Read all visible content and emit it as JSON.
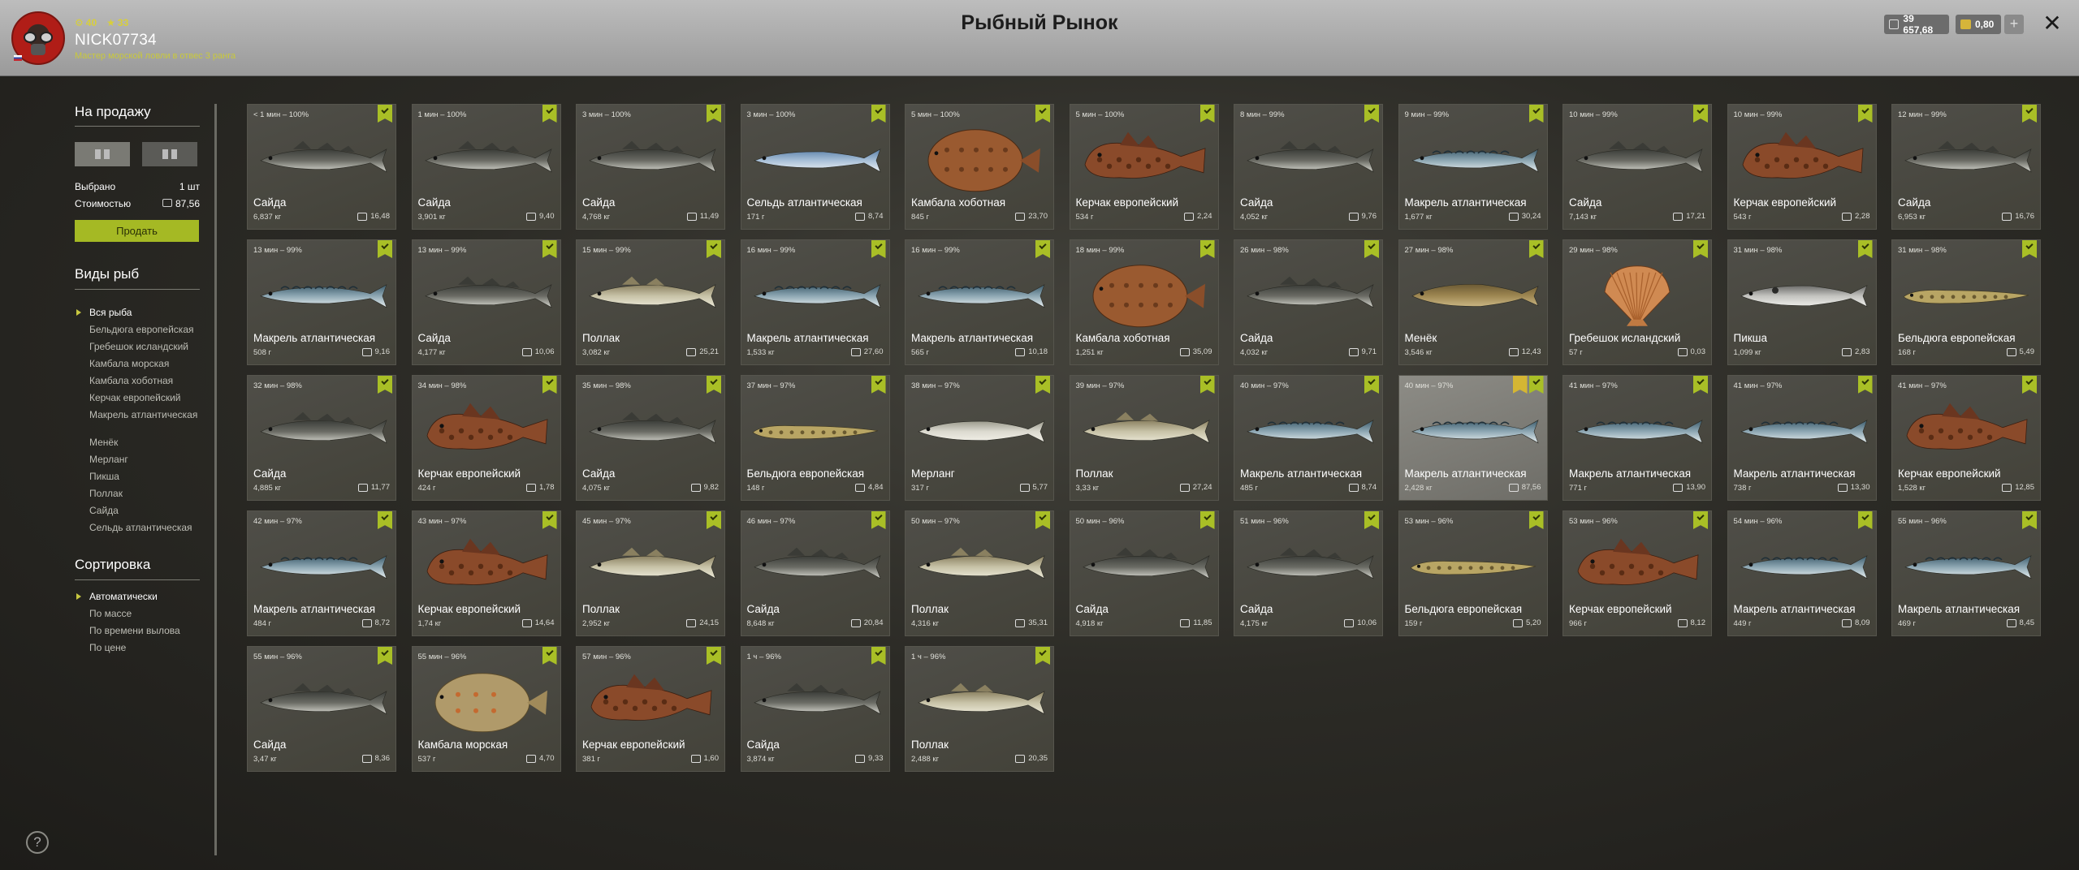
{
  "header": {
    "page_title": "Рыбный Рынок",
    "user": {
      "level": "40",
      "rank": "33",
      "name": "NICK07734",
      "title": "Мастер морской ловли в отвес 3 ранга"
    },
    "currency": {
      "silver": "39 657,68",
      "gold": "0,80"
    },
    "plus_label": "+",
    "close_label": "✕"
  },
  "left": {
    "sale_title": "На продажу",
    "selected_label": "Выбрано",
    "selected_value": "1 шт",
    "cost_label": "Стоимостью",
    "cost_value": "87,56",
    "sell_button": "Продать",
    "species_title": "Виды рыб",
    "species": [
      "Вся рыба",
      "Бельдюга европейская",
      "Гребешок исландский",
      "Камбала морская",
      "Камбала хоботная",
      "Керчак европейский",
      "Макрель атлантическая",
      "Менёк",
      "Мерланг",
      "Пикша",
      "Поллак",
      "Сайда",
      "Сельдь атлантическая"
    ],
    "sort_title": "Сортировка",
    "sort": [
      "Автоматически",
      "По массе",
      "По времени вылова",
      "По цене"
    ],
    "help": "?"
  },
  "icons": {
    "close": "close-icon",
    "check": "check-icon",
    "coin": "coin-icon",
    "help": "help-icon",
    "grid": "grid-view-icon"
  },
  "colors": {
    "accent": "#a9bf26",
    "gold": "#d5b633",
    "card": "#4a4943"
  },
  "catches": [
    {
      "time": "< 1 мин – 100%",
      "name": "Сайда",
      "weight": "6,837 кг",
      "price": "16,48",
      "kind": "saithe"
    },
    {
      "time": "1 мин – 100%",
      "name": "Сайда",
      "weight": "3,901 кг",
      "price": "9,40",
      "kind": "saithe"
    },
    {
      "time": "3 мин – 100%",
      "name": "Сайда",
      "weight": "4,768 кг",
      "price": "11,49",
      "kind": "saithe"
    },
    {
      "time": "3 мин – 100%",
      "name": "Сельдь атлантическая",
      "weight": "171 г",
      "price": "8,74",
      "kind": "herring"
    },
    {
      "time": "5 мин – 100%",
      "name": "Камбала хоботная",
      "weight": "845 г",
      "price": "23,70",
      "kind": "flounder"
    },
    {
      "time": "5 мин – 100%",
      "name": "Керчак европейский",
      "weight": "534 г",
      "price": "2,24",
      "kind": "sculpin"
    },
    {
      "time": "8 мин – 99%",
      "name": "Сайда",
      "weight": "4,052 кг",
      "price": "9,76",
      "kind": "saithe"
    },
    {
      "time": "9 мин – 99%",
      "name": "Макрель атлантическая",
      "weight": "1,677 кг",
      "price": "30,24",
      "kind": "mackerel"
    },
    {
      "time": "10 мин – 99%",
      "name": "Сайда",
      "weight": "7,143 кг",
      "price": "17,21",
      "kind": "saithe"
    },
    {
      "time": "10 мин – 99%",
      "name": "Керчак европейский",
      "weight": "543 г",
      "price": "2,28",
      "kind": "sculpin"
    },
    {
      "time": "12 мин – 99%",
      "name": "Сайда",
      "weight": "6,953 кг",
      "price": "16,76",
      "kind": "saithe"
    },
    {
      "time": "13 мин – 99%",
      "name": "Макрель атлантическая",
      "weight": "508 г",
      "price": "9,16",
      "kind": "mackerel"
    },
    {
      "time": "13 мин – 99%",
      "name": "Сайда",
      "weight": "4,177 кг",
      "price": "10,06",
      "kind": "saithe"
    },
    {
      "time": "15 мин – 99%",
      "name": "Поллак",
      "weight": "3,082 кг",
      "price": "25,21",
      "kind": "pollack"
    },
    {
      "time": "16 мин – 99%",
      "name": "Макрель атлантическая",
      "weight": "1,533 кг",
      "price": "27,60",
      "kind": "mackerel"
    },
    {
      "time": "16 мин – 99%",
      "name": "Макрель атлантическая",
      "weight": "565 г",
      "price": "10,18",
      "kind": "mackerel"
    },
    {
      "time": "18 мин – 99%",
      "name": "Камбала хоботная",
      "weight": "1,251 кг",
      "price": "35,09",
      "kind": "flounder"
    },
    {
      "time": "26 мин – 98%",
      "name": "Сайда",
      "weight": "4,032 кг",
      "price": "9,71",
      "kind": "saithe"
    },
    {
      "time": "27 мин – 98%",
      "name": "Менёк",
      "weight": "3,546 кг",
      "price": "12,43",
      "kind": "tusk"
    },
    {
      "time": "29 мин – 98%",
      "name": "Гребешок исландский",
      "weight": "57 г",
      "price": "0,03",
      "kind": "scallop"
    },
    {
      "time": "31 мин – 98%",
      "name": "Пикша",
      "weight": "1,099 кг",
      "price": "2,83",
      "kind": "haddock"
    },
    {
      "time": "31 мин – 98%",
      "name": "Бельдюга европейская",
      "weight": "168 г",
      "price": "5,49",
      "kind": "eelpout"
    },
    {
      "time": "32 мин – 98%",
      "name": "Сайда",
      "weight": "4,885 кг",
      "price": "11,77",
      "kind": "saithe"
    },
    {
      "time": "34 мин – 98%",
      "name": "Керчак европейский",
      "weight": "424 г",
      "price": "1,78",
      "kind": "sculpin"
    },
    {
      "time": "35 мин – 98%",
      "name": "Сайда",
      "weight": "4,075 кг",
      "price": "9,82",
      "kind": "saithe"
    },
    {
      "time": "37 мин – 97%",
      "name": "Бельдюга европейская",
      "weight": "148 г",
      "price": "4,84",
      "kind": "eelpout"
    },
    {
      "time": "38 мин – 97%",
      "name": "Мерланг",
      "weight": "317 г",
      "price": "5,77",
      "kind": "whiting"
    },
    {
      "time": "39 мин – 97%",
      "name": "Поллак",
      "weight": "3,33 кг",
      "price": "27,24",
      "kind": "pollack"
    },
    {
      "time": "40 мин – 97%",
      "name": "Макрель атлантическая",
      "weight": "485 г",
      "price": "8,74",
      "kind": "mackerel"
    },
    {
      "time": "40 мин – 97%",
      "name": "Макрель атлантическая",
      "weight": "2,428 кг",
      "price": "87,56",
      "kind": "mackerel",
      "highlight": true,
      "trophy": true
    },
    {
      "time": "41 мин – 97%",
      "name": "Макрель атлантическая",
      "weight": "771 г",
      "price": "13,90",
      "kind": "mackerel"
    },
    {
      "time": "41 мин – 97%",
      "name": "Макрель атлантическая",
      "weight": "738 г",
      "price": "13,30",
      "kind": "mackerel"
    },
    {
      "time": "41 мин – 97%",
      "name": "Керчак европейский",
      "weight": "1,528 кг",
      "price": "12,85",
      "kind": "sculpin"
    },
    {
      "time": "42 мин – 97%",
      "name": "Макрель атлантическая",
      "weight": "484 г",
      "price": "8,72",
      "kind": "mackerel"
    },
    {
      "time": "43 мин – 97%",
      "name": "Керчак европейский",
      "weight": "1,74 кг",
      "price": "14,64",
      "kind": "sculpin"
    },
    {
      "time": "45 мин – 97%",
      "name": "Поллак",
      "weight": "2,952 кг",
      "price": "24,15",
      "kind": "pollack"
    },
    {
      "time": "46 мин – 97%",
      "name": "Сайда",
      "weight": "8,648 кг",
      "price": "20,84",
      "kind": "saithe"
    },
    {
      "time": "50 мин – 97%",
      "name": "Поллак",
      "weight": "4,316 кг",
      "price": "35,31",
      "kind": "pollack"
    },
    {
      "time": "50 мин – 96%",
      "name": "Сайда",
      "weight": "4,918 кг",
      "price": "11,85",
      "kind": "saithe"
    },
    {
      "time": "51 мин – 96%",
      "name": "Сайда",
      "weight": "4,175 кг",
      "price": "10,06",
      "kind": "saithe"
    },
    {
      "time": "53 мин – 96%",
      "name": "Бельдюга европейская",
      "weight": "159 г",
      "price": "5,20",
      "kind": "eelpout"
    },
    {
      "time": "53 мин – 96%",
      "name": "Керчак европейский",
      "weight": "966 г",
      "price": "8,12",
      "kind": "sculpin"
    },
    {
      "time": "54 мин – 96%",
      "name": "Макрель атлантическая",
      "weight": "449 г",
      "price": "8,09",
      "kind": "mackerel"
    },
    {
      "time": "55 мин – 96%",
      "name": "Макрель атлантическая",
      "weight": "469 г",
      "price": "8,45",
      "kind": "mackerel"
    },
    {
      "time": "55 мин – 96%",
      "name": "Сайда",
      "weight": "3,47 кг",
      "price": "8,36",
      "kind": "saithe"
    },
    {
      "time": "55 мин – 96%",
      "name": "Камбала морская",
      "weight": "537 г",
      "price": "4,70",
      "kind": "plaice"
    },
    {
      "time": "57 мин – 96%",
      "name": "Керчак европейский",
      "weight": "381 г",
      "price": "1,60",
      "kind": "sculpin"
    },
    {
      "time": "1 ч – 96%",
      "name": "Сайда",
      "weight": "3,874 кг",
      "price": "9,33",
      "kind": "saithe"
    },
    {
      "time": "1 ч – 96%",
      "name": "Поллак",
      "weight": "2,488 кг",
      "price": "20,35",
      "kind": "pollack"
    }
  ]
}
